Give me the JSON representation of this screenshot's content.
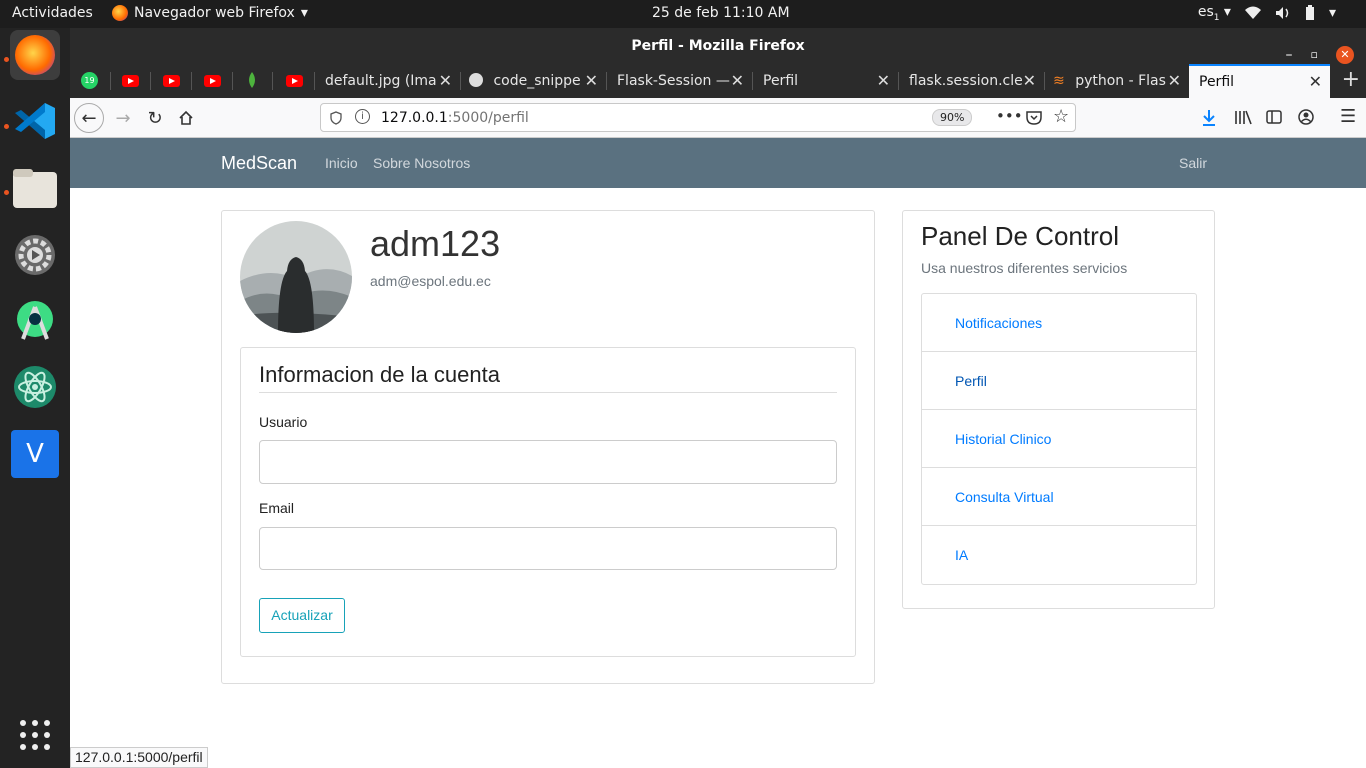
{
  "system": {
    "activities": "Actividades",
    "app_menu": "Navegador web Firefox",
    "clock": "25 de feb  11:10 AM",
    "keyboard": "es",
    "keyboard_sub": "1"
  },
  "window": {
    "title": "Perfil - Mozilla Firefox"
  },
  "tabs": [
    {
      "label": "default.jpg (Ima"
    },
    {
      "label": "code_snippe"
    },
    {
      "label": "Flask-Session —"
    },
    {
      "label": "Perfil"
    },
    {
      "label": "flask.session.cle"
    },
    {
      "label": "python - Flas"
    },
    {
      "label": "Perfil"
    }
  ],
  "pinned_badge": "19",
  "urlbar": {
    "host": "127.0.0.1",
    "rest": ":5000/perfil",
    "zoom": "90%"
  },
  "app": {
    "brand": "MedScan",
    "nav": [
      "Inicio",
      "Sobre Nosotros"
    ],
    "logout": "Salir"
  },
  "profile": {
    "username": "adm123",
    "email": "adm@espol.edu.ec"
  },
  "account": {
    "title": "Informacion de la cuenta",
    "user_label": "Usuario",
    "user_value": "",
    "email_label": "Email",
    "email_value": "",
    "update_button": "Actualizar"
  },
  "panel": {
    "title": "Panel De Control",
    "subtitle": "Usa nuestros diferentes servicios",
    "items": [
      "Notificaciones",
      "Perfil",
      "Historial Clinico",
      "Consulta Virtual",
      "IA"
    ]
  },
  "status_url": "127.0.0.1:5000/perfil",
  "colors": {
    "navbar": "#5a7180",
    "link": "#007bff",
    "update_button": "#17a2b8",
    "close": "#e95420"
  }
}
